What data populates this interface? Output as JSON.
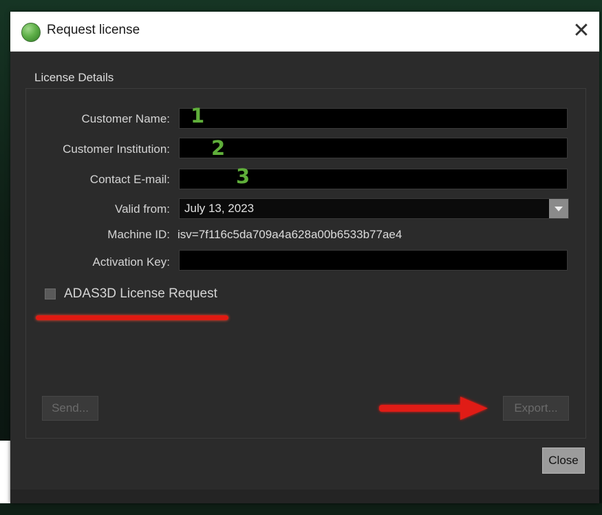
{
  "window": {
    "title": "Request license",
    "close_glyph": "✕"
  },
  "section": {
    "title": "License Details"
  },
  "form": {
    "customer_name": {
      "label": "Customer Name:",
      "value": "",
      "annotation": "1"
    },
    "customer_institution": {
      "label": "Customer Institution:",
      "value": "",
      "annotation": "2"
    },
    "contact_email": {
      "label": "Contact E-mail:",
      "value": "",
      "annotation": "3"
    },
    "valid_from": {
      "label": "Valid from:",
      "value": "July 13, 2023"
    },
    "machine_id": {
      "label": "Machine ID:",
      "value": "isv=7f116c5da709a4a628a00b6533b77ae4"
    },
    "activation_key": {
      "label": "Activation Key:",
      "value": ""
    }
  },
  "checkbox": {
    "label": "ADAS3D License Request",
    "checked": false
  },
  "buttons": {
    "send": "Send...",
    "export": "Export...",
    "close": "Close"
  },
  "colors": {
    "annotation_red": "#e01a12",
    "annotation_green": "#5fae3a",
    "dialog_bg": "#2b2b2b"
  },
  "icons": {
    "app": "green-orb-icon",
    "close": "close-icon",
    "dropdown": "chevron-down-icon",
    "arrow": "red-arrow-annotation"
  }
}
